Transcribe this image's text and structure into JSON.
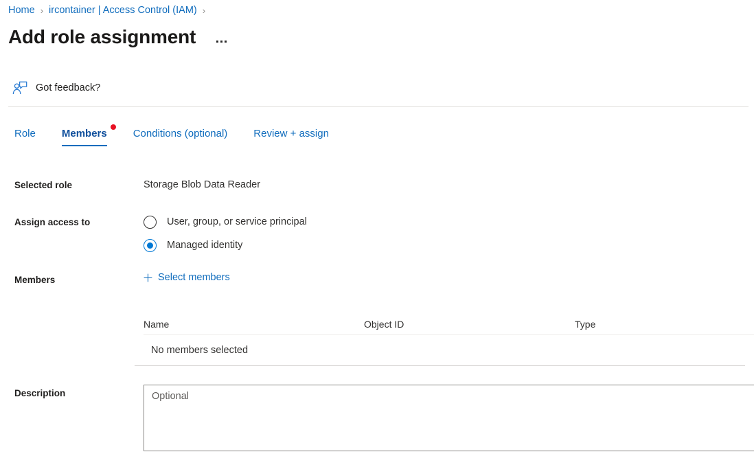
{
  "breadcrumb": {
    "items": [
      {
        "label": "Home",
        "separator": "›"
      },
      {
        "label": "ircontainer | Access Control (IAM)",
        "separator": "›"
      }
    ],
    "home_label": "Home",
    "resource_label": "ircontainer | Access Control (IAM)",
    "separator": "›"
  },
  "header": {
    "title": "Add role assignment",
    "more_actions": "···"
  },
  "feedback": {
    "icon": "feedback-person-icon",
    "label": "Got feedback?"
  },
  "tabs": [
    {
      "label": "Role",
      "active": false,
      "badge": false
    },
    {
      "label": "Members",
      "active": true,
      "badge": true
    },
    {
      "label": "Conditions (optional)",
      "active": false,
      "badge": false
    },
    {
      "label": "Review + assign",
      "active": false,
      "badge": false
    }
  ],
  "form": {
    "selected_role": {
      "label": "Selected role",
      "value": "Storage Blob Data Reader"
    },
    "assign_access_to": {
      "label": "Assign access to",
      "options": [
        {
          "label": "User, group, or service principal",
          "checked": false
        },
        {
          "label": "Managed identity",
          "checked": true
        }
      ]
    },
    "members": {
      "label": "Members",
      "select_members_link": "Select members",
      "plus_icon": "plus-icon"
    },
    "description": {
      "label": "Description",
      "placeholder": "Optional",
      "value": ""
    }
  },
  "members_table": {
    "columns": [
      "Name",
      "Object ID",
      "Type"
    ],
    "empty_message": "No members selected",
    "rows": []
  },
  "colors": {
    "link_blue": "#0f6cbd",
    "accent_blue": "#0078d4",
    "badge_red": "#e81123",
    "text_dark": "#201f1e",
    "border_grey": "#8a8886",
    "divider_light": "#e1dfdd"
  }
}
